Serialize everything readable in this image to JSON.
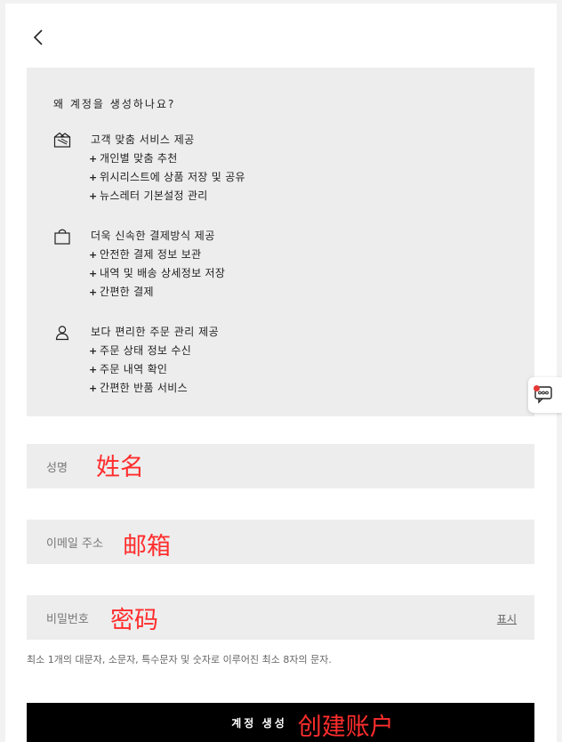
{
  "header": {
    "back_icon": "chevron-left-icon"
  },
  "info": {
    "title": "왜 계정을 생성하나요?",
    "sections": [
      {
        "icon": "ticket-icon",
        "title": "고객 맞춤 서비스 제공",
        "items": [
          "개인별 맞춤 추천",
          "위시리스트에 상품 저장 및 공유",
          "뉴스레터 기본설정 관리"
        ]
      },
      {
        "icon": "shopping-bag-icon",
        "title": "더욱 신속한 결제방식 제공",
        "items": [
          "안전한 결제 정보 보관",
          "내역 및 배송 상세정보 저장",
          "간편한 결제"
        ]
      },
      {
        "icon": "user-icon",
        "title": "보다 편리한 주문 관리 제공",
        "items": [
          "주문 상태 정보 수신",
          "주문 내역 확인",
          "간편한 반품 서비스"
        ]
      }
    ],
    "bullet": "+"
  },
  "form": {
    "name": {
      "label": "성명",
      "note": "姓名",
      "value": ""
    },
    "email": {
      "label": "이메일 주소",
      "note": "邮箱",
      "value": ""
    },
    "password": {
      "label": "비밀번호",
      "note": "密码",
      "value": "",
      "show_label": "표시"
    },
    "password_hint": "최소 1개의 대문자, 소문자, 특수문자 및 숫자로 이루어진 최소 8자의 문자.",
    "submit": {
      "label": "계정 생성",
      "note": "创建账户"
    }
  },
  "chat": {
    "icon": "chat-bubble-icon",
    "badge_color": "#e53935"
  },
  "colors": {
    "panel_bg": "#ededed",
    "button_bg": "#000000",
    "annotation": "#ff2d2d"
  }
}
